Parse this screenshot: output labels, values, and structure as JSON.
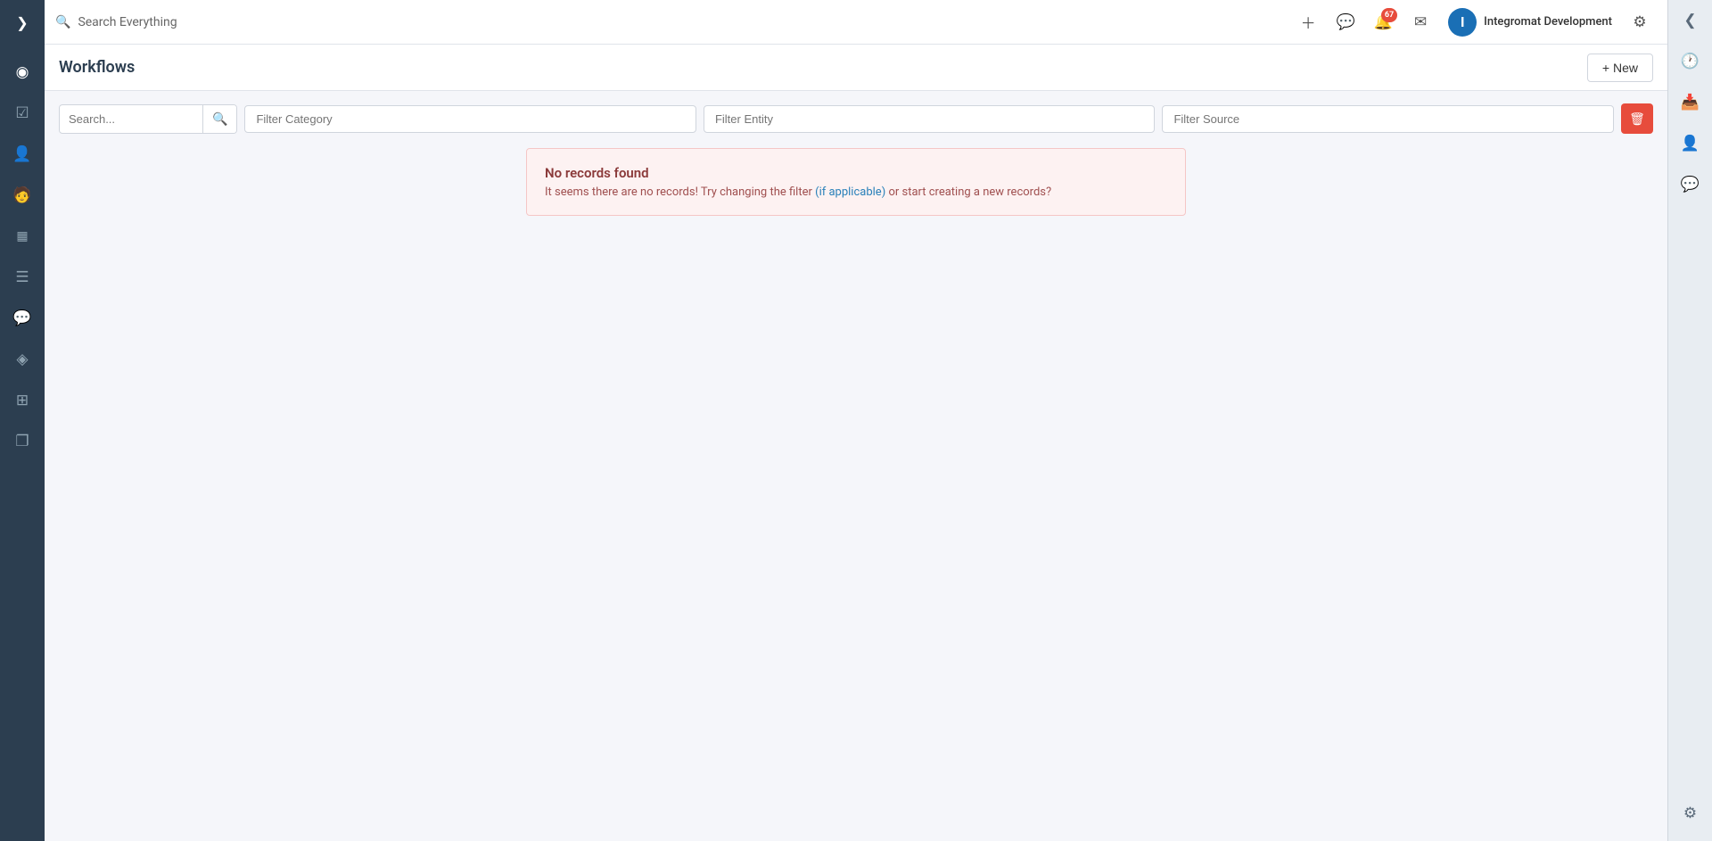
{
  "header": {
    "search_placeholder": "Search Everything",
    "notification_count": "67",
    "user_name": "Integromat Development",
    "user_avatar_letter": "I"
  },
  "page": {
    "title": "Workflows",
    "new_button_label": "+ New"
  },
  "filters": {
    "search_placeholder": "Search...",
    "category_placeholder": "Filter Category",
    "entity_placeholder": "Filter Entity",
    "source_placeholder": "Filter Source"
  },
  "no_records": {
    "title": "No records found",
    "description": "It seems there are no records! Try changing the filter (if applicable) or start creating a new records?"
  },
  "sidebar": {
    "items": [
      {
        "name": "expand-icon",
        "icon": "❯",
        "active": false
      },
      {
        "name": "dashboard-icon",
        "icon": "◉",
        "active": false
      },
      {
        "name": "calendar-icon",
        "icon": "☑",
        "active": false
      },
      {
        "name": "contacts-icon",
        "icon": "👤",
        "active": false
      },
      {
        "name": "person-icon",
        "icon": "🧑",
        "active": false
      },
      {
        "name": "table-icon",
        "icon": "▦",
        "active": false
      },
      {
        "name": "list-icon",
        "icon": "☰",
        "active": false
      },
      {
        "name": "chat-icon",
        "icon": "💬",
        "active": false
      },
      {
        "name": "badge-icon",
        "icon": "◈",
        "active": false
      },
      {
        "name": "data-icon",
        "icon": "⊞",
        "active": false
      },
      {
        "name": "pages-icon",
        "icon": "❐",
        "active": false
      }
    ]
  },
  "right_sidebar": {
    "items": [
      {
        "name": "collapse-icon",
        "icon": "❮"
      },
      {
        "name": "clock-icon",
        "icon": "🕐"
      },
      {
        "name": "inbox-icon",
        "icon": "📥"
      },
      {
        "name": "user-sidebar-icon",
        "icon": "👤"
      },
      {
        "name": "comment-icon",
        "icon": "💬"
      }
    ],
    "footer": {
      "name": "settings-footer-icon",
      "icon": "⚙"
    }
  }
}
